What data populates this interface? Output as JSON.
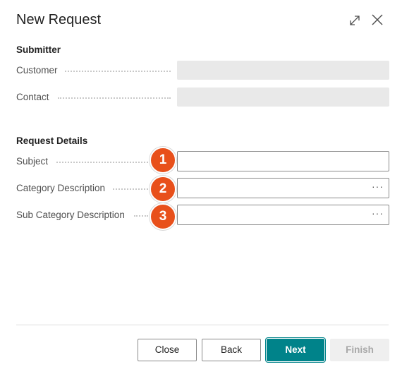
{
  "dialog": {
    "title": "New Request"
  },
  "submitter": {
    "heading": "Submitter",
    "customer_label": "Customer",
    "customer_value": "",
    "contact_label": "Contact",
    "contact_value": ""
  },
  "details": {
    "heading": "Request Details",
    "subject_label": "Subject",
    "subject_value": "",
    "category_label": "Category Description",
    "category_value": "",
    "subcategory_label": "Sub Category Description",
    "subcategory_value": "",
    "ellipsis": "···"
  },
  "badges": [
    "1",
    "2",
    "3"
  ],
  "colors": {
    "accent": "#00838a",
    "badge": "#e8501b",
    "readonly_field": "#e9e9e9"
  },
  "footer": {
    "close": "Close",
    "back": "Back",
    "next": "Next",
    "finish": "Finish"
  },
  "icons": {
    "expand": "expand-icon",
    "close": "close-icon"
  }
}
